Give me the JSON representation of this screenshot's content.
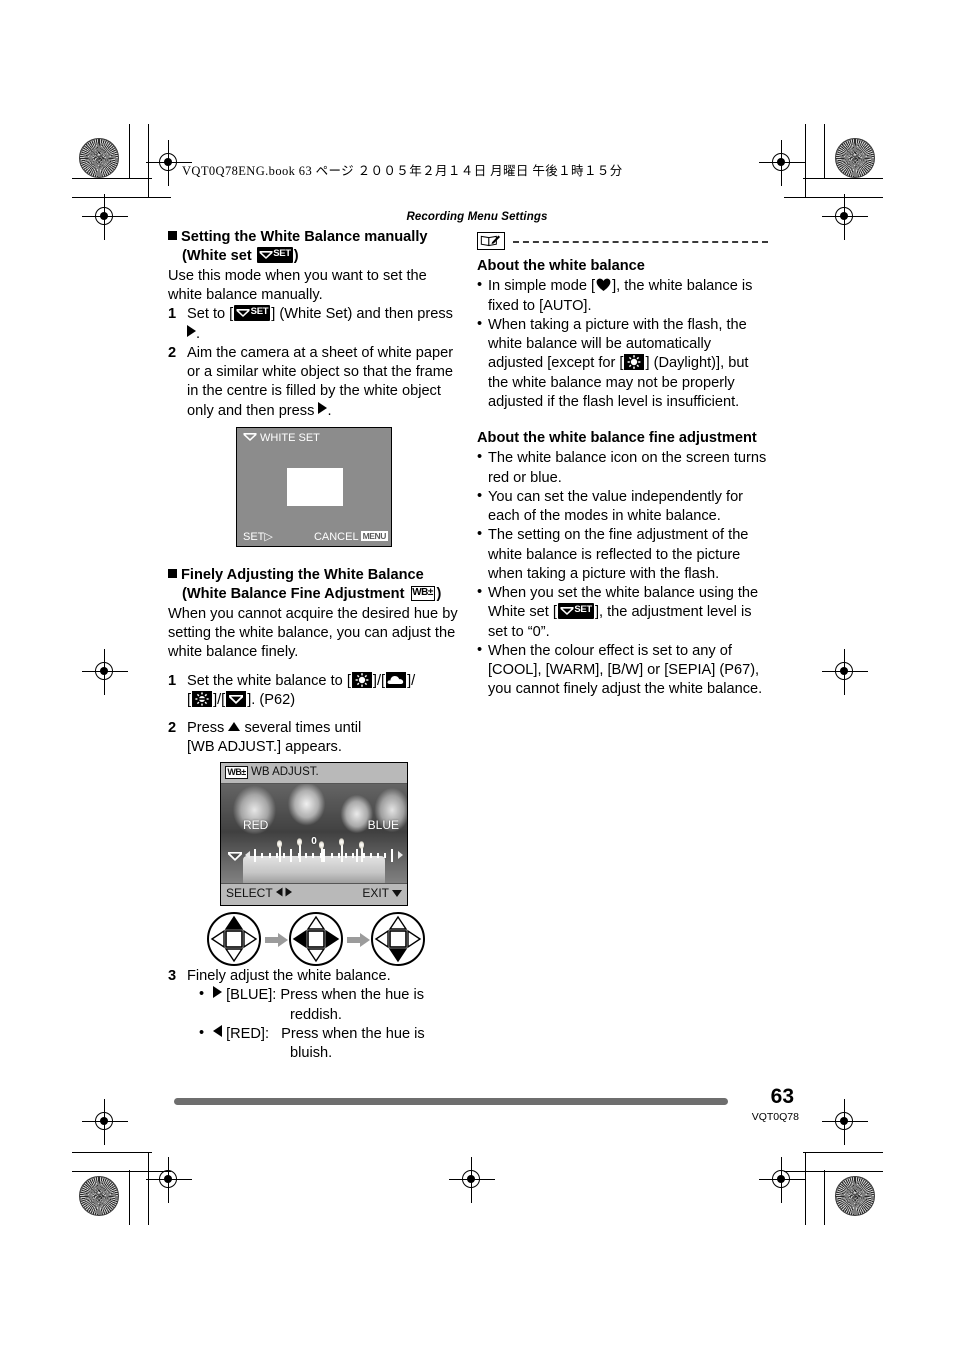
{
  "document": {
    "book_line": "VQT0Q78ENG.book   63 ページ   ２００５年２月１４日   月曜日   午後１時１５分",
    "running_head": "Recording Menu Settings",
    "page_number": "63",
    "doc_code": "VQT0Q78"
  },
  "left_column": {
    "section1": {
      "heading_line1": "Setting the White Balance manually",
      "heading_line2_pre": "(White set",
      "heading_line2_post": ")",
      "intro": "Use this mode when you want to set the white balance manually.",
      "steps": [
        {
          "num": "1",
          "text_pre": "Set to [",
          "text_post": "] (White Set) and then press",
          "text_end": "."
        },
        {
          "num": "2",
          "text_pre": "Aim the camera at a sheet of white paper or a similar white object so that the frame in the centre is filled by the white object only and then press",
          "text_post": "."
        }
      ]
    },
    "white_set_screen": {
      "title": "WHITE SET",
      "footer_left": "SET",
      "footer_left_arrow": "▷",
      "footer_right": "CANCEL",
      "menu_chip": "MENU"
    },
    "section2": {
      "heading_line1": "Finely Adjusting the White Balance",
      "heading_line2_pre": "(White Balance Fine Adjustment",
      "heading_line2_post": ")",
      "intro": "When you cannot acquire the desired hue by setting the white balance, you can adjust the white balance finely.",
      "steps": [
        {
          "num": "1",
          "text_pre": "Set the white balance to [",
          "sep1": "]/[",
          "sep2": "]/",
          "line2_pre": "[",
          "sep3": "]/[",
          "text_post": "]. (P62)"
        },
        {
          "num": "2",
          "line1_pre": "Press",
          "line1_post": "several times until",
          "line2": "[WB ADJUST.] appears."
        },
        {
          "num": "3",
          "text": "Finely adjust the white balance.",
          "bullets": [
            {
              "arrow": "right",
              "label": "[BLUE]:",
              "desc_line1": "Press when the hue is",
              "desc_line2": "reddish."
            },
            {
              "arrow": "left",
              "label": "[RED]:",
              "desc_line1": "Press when the hue is",
              "desc_line2": "bluish."
            }
          ]
        }
      ]
    },
    "wb_adjust_screen": {
      "chip": "WB±",
      "title": "WB ADJUST.",
      "label_red": "RED",
      "label_blue": "BLUE",
      "scale_value": "0",
      "footer_left": "SELECT",
      "footer_right": "EXIT"
    },
    "dpad_sequence": [
      {
        "highlighted": "up"
      },
      {
        "highlighted": "left-right"
      },
      {
        "highlighted": "down"
      }
    ]
  },
  "right_column": {
    "note_block": {
      "icon": "note-pencil-icon",
      "heading1": "About the white balance",
      "bullets1": [
        {
          "pre": "In simple mode [",
          "icon": "heart-icon",
          "post": "], the white balance is fixed to [AUTO]."
        },
        {
          "pre": "When taking a picture with the flash, the white balance will be automatically adjusted [except for [",
          "icon": "daylight-icon",
          "post": "] (Daylight)], but the white balance may not be properly adjusted if the flash level is insufficient."
        }
      ],
      "heading2": "About the white balance fine adjustment",
      "bullets2": [
        {
          "text": "The white balance icon on the screen turns red or blue."
        },
        {
          "text": "You can set the value independently for each of the modes in white balance."
        },
        {
          "text": "The setting on the fine adjustment of the white balance is reflected to the picture when taking a picture with the flash."
        },
        {
          "pre": "When you set the white balance using the White set [",
          "icon": "whiteset-icon",
          "post": "], the adjustment level is set to “0”."
        },
        {
          "text": "When the colour effect is set to any of [COOL], [WARM], [B/W] or [SEPIA] (P67), you cannot finely adjust the white balance."
        }
      ]
    }
  },
  "icons": {
    "whiteset_set_label": "SET",
    "wb_plus_minus_label": "WB±"
  },
  "colors": {
    "lcd_background": "#8c8c8c",
    "lcd_bar": "#b9b9b9",
    "rule": "#6e6e6e",
    "text": "#000000"
  }
}
